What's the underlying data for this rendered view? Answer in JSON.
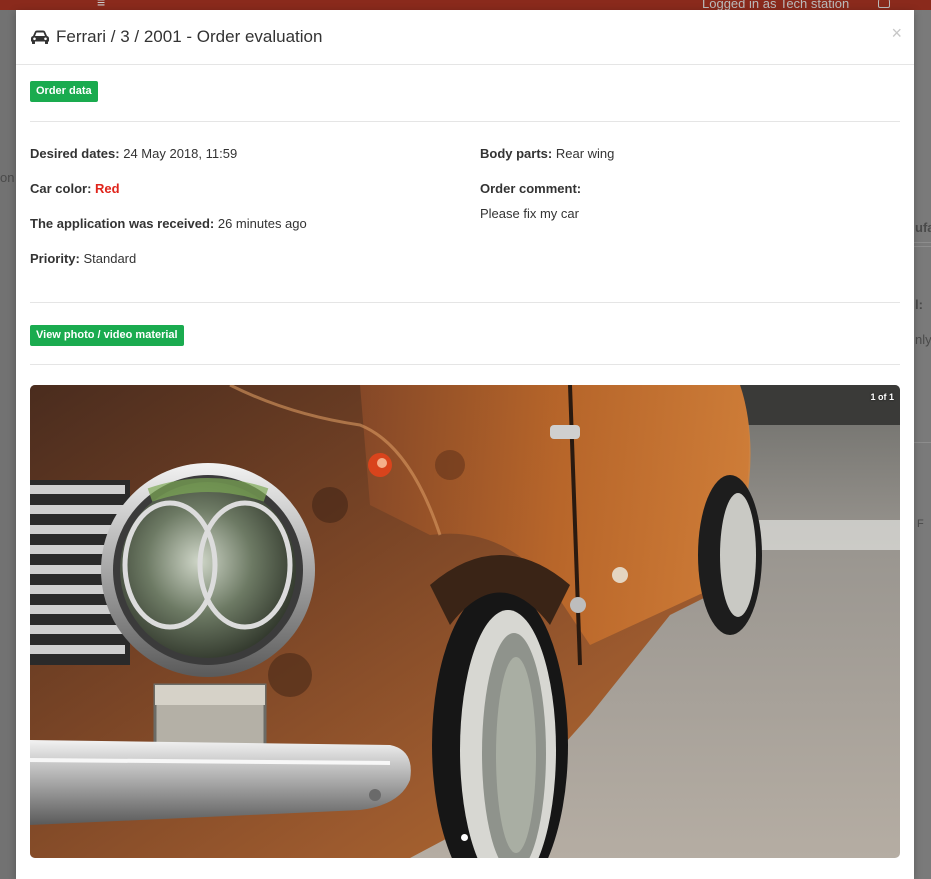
{
  "background": {
    "logged_in_text": "Logged in as Tech station",
    "left_fragment": "on",
    "right_fragments": [
      "ufa",
      "l:",
      "nly",
      "F"
    ]
  },
  "modal": {
    "title": "Ferrari / 3 / 2001 - Order evaluation",
    "title_icon": "car-icon",
    "close_label": "×"
  },
  "order_data_badge": "Order data",
  "fields": {
    "desired_dates": {
      "label": "Desired dates:",
      "value": "24 May 2018, 11:59"
    },
    "car_color": {
      "label": "Car color:",
      "value": "Red",
      "color": "#e0241b"
    },
    "application_received": {
      "label": "The application was received:",
      "value": "26 minutes ago"
    },
    "priority": {
      "label": "Priority:",
      "value": "Standard"
    },
    "body_parts": {
      "label": "Body parts:",
      "value": "Rear wing"
    },
    "order_comment": {
      "label": "Order comment:",
      "value": "Please fix my car"
    }
  },
  "media_badge": "View photo / video material",
  "gallery": {
    "counter": "1 of 1",
    "image_subject": "rusty vintage car front headlight and wheel"
  },
  "colors": {
    "badge_green": "#1aab4f",
    "accent_red": "#e0241b"
  }
}
